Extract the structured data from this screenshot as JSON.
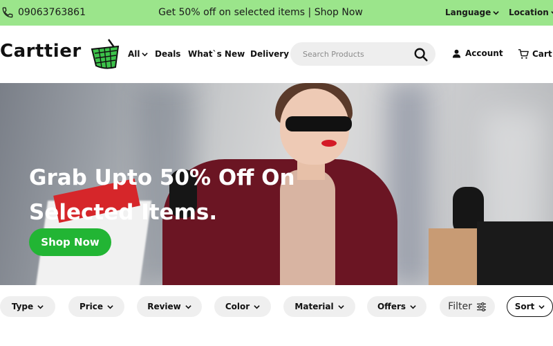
{
  "topbar": {
    "phone": "09063763861",
    "promo": "Get 50% off on selected items | Shop Now",
    "language": "Language",
    "location": "Location"
  },
  "header": {
    "logo": "Carttier",
    "nav": {
      "all": "All",
      "deals": "Deals",
      "whats_new": "What`s New",
      "delivery": "Delivery"
    },
    "search": {
      "placeholder": "Search Products"
    },
    "account": "Account",
    "cart": "Cart"
  },
  "hero": {
    "title_line1": "Grab Upto 50% Off On",
    "title_line2": "Selected Items.",
    "button": "Shop Now"
  },
  "filters": {
    "type": "Type",
    "price": "Price",
    "review": "Review",
    "color": "Color",
    "material": "Material",
    "offers": "Offers",
    "filter": "Filter",
    "sort": "Sort"
  },
  "colors": {
    "topbar_bg": "#9be58b",
    "accent_green": "#22b534",
    "chip_bg": "#efefef"
  },
  "icons": [
    "phone-icon",
    "chevron-down-icon",
    "basket-logo-icon",
    "search-icon",
    "user-icon",
    "cart-icon",
    "sliders-icon"
  ]
}
